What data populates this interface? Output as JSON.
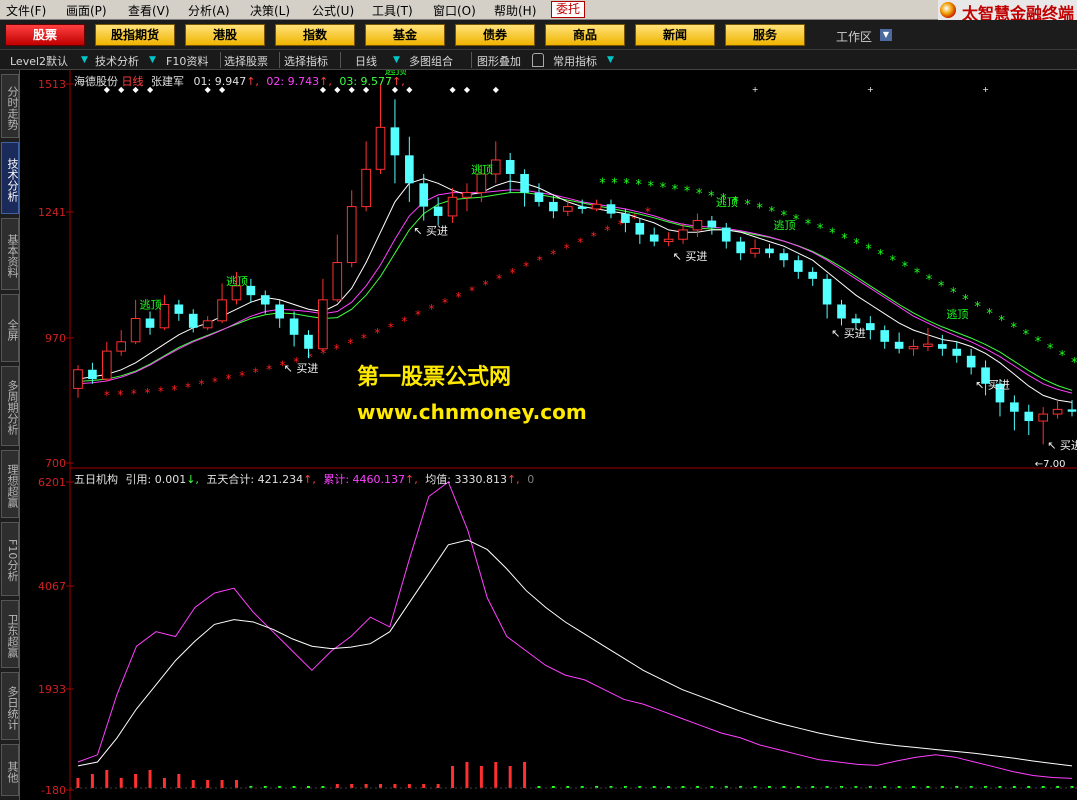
{
  "menu": [
    "文件(F)",
    "画面(P)",
    "查看(V)",
    "分析(A)",
    "决策(L)",
    "公式(U)",
    "工具(T)",
    "窗口(O)",
    "帮助(H)"
  ],
  "entrust_label": "委托",
  "brand_text": "太智慧金融终端",
  "toolbar": {
    "buttons": [
      "股票",
      "股指期货",
      "港股",
      "指数",
      "基金",
      "债券",
      "商品",
      "新闻",
      "服务"
    ],
    "workspace_label": "工作区"
  },
  "tabs": [
    "Level2默认",
    "技术分析",
    "F10资料",
    "选择股票",
    "选择指标",
    "日线",
    "多图组合",
    "图形叠加",
    "常用指标"
  ],
  "sidebar": [
    "分时走势",
    "技术分析",
    "基本资料",
    "全屏",
    "多周期分析",
    "理想超赢",
    "F10分析",
    "卫东超赢",
    "多日统计",
    "其他"
  ],
  "top_panel": {
    "stock": "海德股份",
    "period": "日线",
    "indicator": "张建军",
    "o1": "01: 9.947",
    "o2": "02: 9.743",
    "o3": "03: 9.577",
    "y_ticks": [
      "1513",
      "1241",
      "970",
      "700"
    ],
    "low_marker": "7.00",
    "buy_label": "买进",
    "escape_label": "逃顶"
  },
  "bottom_panel": {
    "name": "五日机构",
    "ref": "引用: 0.001",
    "five_day": "五天合计: 421.234",
    "cumulative": "累计: 4460.137",
    "average": "均值: 3330.813",
    "zero": "0",
    "y_ticks": [
      "6201",
      "4067",
      "1933",
      "-180"
    ]
  },
  "watermark": {
    "line1": "第一股票公式网",
    "line2": "www.chnmoney.com"
  },
  "colors": {
    "up": "#ff3030",
    "down": "#54ffff",
    "ma_white": "#ffffff",
    "ma_magenta": "#ff40ff",
    "ma_green": "#40ff40",
    "star_red": "#ff2020",
    "star_green": "#20ff20",
    "watermark": "#ffea00"
  },
  "chart_data": {
    "type": "candlestick",
    "price_range": [
      700,
      1513
    ],
    "candles": [
      [
        860,
        900,
        840,
        910
      ],
      [
        900,
        880,
        870,
        915
      ],
      [
        880,
        940,
        875,
        960
      ],
      [
        940,
        960,
        930,
        985
      ],
      [
        960,
        1010,
        955,
        1050
      ],
      [
        1010,
        990,
        975,
        1025
      ],
      [
        990,
        1040,
        985,
        1060
      ],
      [
        1040,
        1020,
        1005,
        1050
      ],
      [
        1020,
        990,
        980,
        1030
      ],
      [
        990,
        1005,
        985,
        1015
      ],
      [
        1005,
        1050,
        1000,
        1085
      ],
      [
        1050,
        1080,
        1040,
        1110
      ],
      [
        1080,
        1060,
        1045,
        1095
      ],
      [
        1060,
        1040,
        1020,
        1070
      ],
      [
        1040,
        1010,
        990,
        1050
      ],
      [
        1010,
        975,
        950,
        1025
      ],
      [
        975,
        945,
        925,
        985
      ],
      [
        945,
        1050,
        940,
        1095
      ],
      [
        1050,
        1130,
        1045,
        1190
      ],
      [
        1130,
        1250,
        1120,
        1285
      ],
      [
        1250,
        1330,
        1240,
        1390
      ],
      [
        1330,
        1420,
        1320,
        1513
      ],
      [
        1420,
        1360,
        1300,
        1480
      ],
      [
        1360,
        1300,
        1260,
        1400
      ],
      [
        1300,
        1250,
        1220,
        1320
      ],
      [
        1250,
        1230,
        1210,
        1270
      ],
      [
        1230,
        1270,
        1215,
        1290
      ],
      [
        1270,
        1280,
        1240,
        1300
      ],
      [
        1280,
        1320,
        1260,
        1340
      ],
      [
        1320,
        1350,
        1300,
        1390
      ],
      [
        1350,
        1320,
        1280,
        1365
      ],
      [
        1320,
        1280,
        1250,
        1330
      ],
      [
        1280,
        1260,
        1250,
        1300
      ],
      [
        1260,
        1240,
        1225,
        1275
      ],
      [
        1240,
        1250,
        1230,
        1265
      ],
      [
        1250,
        1245,
        1235,
        1265
      ],
      [
        1245,
        1255,
        1240,
        1265
      ],
      [
        1255,
        1235,
        1225,
        1265
      ],
      [
        1235,
        1215,
        1195,
        1245
      ],
      [
        1215,
        1190,
        1170,
        1225
      ],
      [
        1190,
        1175,
        1165,
        1205
      ],
      [
        1175,
        1180,
        1165,
        1195
      ],
      [
        1180,
        1200,
        1170,
        1215
      ],
      [
        1200,
        1220,
        1185,
        1235
      ],
      [
        1220,
        1205,
        1190,
        1230
      ],
      [
        1205,
        1175,
        1160,
        1215
      ],
      [
        1175,
        1150,
        1135,
        1185
      ],
      [
        1150,
        1160,
        1140,
        1180
      ],
      [
        1160,
        1150,
        1140,
        1170
      ],
      [
        1150,
        1135,
        1120,
        1160
      ],
      [
        1135,
        1110,
        1095,
        1145
      ],
      [
        1110,
        1095,
        1080,
        1120
      ],
      [
        1095,
        1040,
        1010,
        1105
      ],
      [
        1040,
        1010,
        995,
        1050
      ],
      [
        1010,
        1000,
        985,
        1020
      ],
      [
        1000,
        985,
        965,
        1015
      ],
      [
        985,
        960,
        945,
        995
      ],
      [
        960,
        945,
        935,
        980
      ],
      [
        945,
        950,
        930,
        965
      ],
      [
        950,
        955,
        940,
        990
      ],
      [
        955,
        945,
        930,
        975
      ],
      [
        945,
        930,
        915,
        960
      ],
      [
        930,
        905,
        890,
        945
      ],
      [
        905,
        870,
        845,
        920
      ],
      [
        870,
        830,
        800,
        880
      ],
      [
        830,
        810,
        770,
        845
      ],
      [
        810,
        790,
        760,
        825
      ],
      [
        790,
        805,
        740,
        820
      ],
      [
        805,
        815,
        795,
        835
      ],
      [
        815,
        810,
        800,
        835
      ]
    ],
    "ma_white": [
      880,
      885,
      890,
      900,
      915,
      935,
      955,
      975,
      990,
      1000,
      1015,
      1030,
      1045,
      1055,
      1050,
      1040,
      1030,
      1025,
      1040,
      1075,
      1130,
      1195,
      1260,
      1300,
      1310,
      1300,
      1285,
      1275,
      1280,
      1295,
      1305,
      1300,
      1290,
      1275,
      1260,
      1250,
      1245,
      1240,
      1235,
      1225,
      1215,
      1200,
      1195,
      1195,
      1200,
      1200,
      1195,
      1185,
      1175,
      1165,
      1150,
      1135,
      1110,
      1085,
      1060,
      1040,
      1020,
      1000,
      985,
      975,
      965,
      960,
      950,
      935,
      915,
      890,
      865,
      845,
      835,
      830
    ],
    "ma_magenta": [
      870,
      872,
      876,
      884,
      895,
      910,
      928,
      945,
      960,
      972,
      985,
      1000,
      1015,
      1025,
      1030,
      1028,
      1025,
      1020,
      1025,
      1045,
      1080,
      1125,
      1180,
      1230,
      1260,
      1275,
      1280,
      1280,
      1280,
      1283,
      1286,
      1285,
      1280,
      1275,
      1268,
      1260,
      1255,
      1250,
      1245,
      1238,
      1230,
      1220,
      1212,
      1208,
      1206,
      1203,
      1198,
      1192,
      1185,
      1176,
      1165,
      1152,
      1135,
      1115,
      1095,
      1075,
      1055,
      1035,
      1015,
      1000,
      985,
      972,
      960,
      945,
      928,
      908,
      888,
      870,
      858,
      850
    ],
    "ma_green": [
      875,
      877,
      880,
      887,
      897,
      912,
      930,
      948,
      962,
      974,
      986,
      998,
      1010,
      1018,
      1022,
      1020,
      1015,
      1010,
      1012,
      1030,
      1060,
      1100,
      1150,
      1200,
      1235,
      1255,
      1265,
      1268,
      1270,
      1275,
      1280,
      1280,
      1276,
      1270,
      1264,
      1258,
      1252,
      1246,
      1240,
      1234,
      1226,
      1217,
      1209,
      1204,
      1202,
      1200,
      1196,
      1190,
      1184,
      1176,
      1166,
      1154,
      1138,
      1120,
      1100,
      1080,
      1060,
      1040,
      1022,
      1006,
      992,
      980,
      968,
      954,
      938,
      918,
      898,
      880,
      866,
      856
    ],
    "star_red": [
      845,
      846,
      848,
      850,
      853,
      857,
      862,
      868,
      874,
      880,
      887,
      894,
      901,
      909,
      917,
      926,
      935,
      945,
      956,
      967,
      979,
      991,
      1004,
      1017,
      1030,
      1043,
      1056,
      1069,
      1082,
      1095,
      1108,
      1121,
      1134,
      1147,
      1160,
      1173,
      1186,
      1199,
      1212,
      1225,
      1238
    ],
    "star_green": [
      1300,
      1300,
      1298,
      1296,
      1293,
      1290,
      1286,
      1282,
      1277,
      1272,
      1266,
      1260,
      1253,
      1246,
      1238,
      1230,
      1221,
      1212,
      1202,
      1192,
      1181,
      1170,
      1158,
      1146,
      1133,
      1120,
      1107,
      1093,
      1079,
      1065,
      1050,
      1035,
      1020,
      1005,
      990,
      975,
      960,
      945,
      930,
      915
    ],
    "bottom_range": [
      -180,
      6201
    ],
    "cumulative": [
      400,
      550,
      1800,
      2800,
      3100,
      3000,
      3600,
      3900,
      4000,
      3500,
      3100,
      2700,
      2300,
      2700,
      3000,
      3400,
      3200,
      4600,
      5900,
      6201,
      5200,
      3800,
      3000,
      2700,
      2400,
      2200,
      2100,
      1900,
      1700,
      1600,
      1450,
      1300,
      1150,
      1000,
      900,
      750,
      650,
      550,
      450,
      400,
      350,
      330,
      420,
      500,
      550,
      500,
      400,
      300,
      200,
      120,
      80,
      60
    ],
    "average": [
      320,
      400,
      900,
      1500,
      2000,
      2500,
      2900,
      3250,
      3350,
      3300,
      3150,
      2950,
      2800,
      2750,
      2780,
      2850,
      3100,
      3700,
      4300,
      4900,
      5000,
      4800,
      4400,
      3950,
      3600,
      3300,
      3050,
      2800,
      2550,
      2300,
      2100,
      1900,
      1750,
      1600,
      1450,
      1320,
      1200,
      1100,
      1000,
      920,
      850,
      790,
      740,
      700,
      660,
      620,
      580,
      530,
      480,
      420,
      370,
      320
    ]
  }
}
